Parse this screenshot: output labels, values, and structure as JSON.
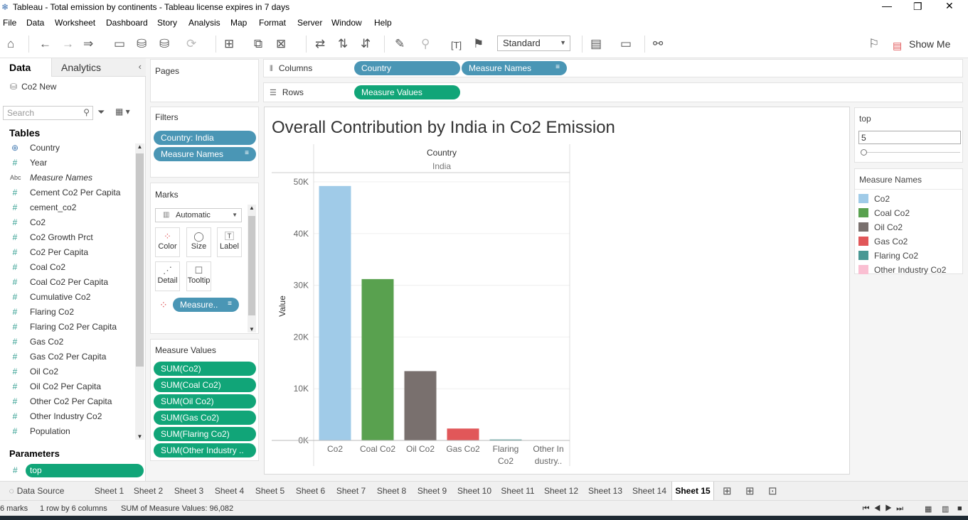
{
  "window": {
    "title": "Tableau - Total emission by continents - Tableau license expires in 7 days"
  },
  "menu": [
    "File",
    "Data",
    "Worksheet",
    "Dashboard",
    "Story",
    "Analysis",
    "Map",
    "Format",
    "Server",
    "Window",
    "Help"
  ],
  "toolbar": {
    "fit_mode": "Standard",
    "show_me_label": "Show Me"
  },
  "data_pane": {
    "tab_data": "Data",
    "tab_analytics": "Analytics",
    "datasource": "Co2 New",
    "search_placeholder": "Search",
    "tables_heading": "Tables",
    "fields": [
      {
        "name": "Country",
        "kind": "geo"
      },
      {
        "name": "Year",
        "kind": "measure"
      },
      {
        "name": "Measure Names",
        "kind": "dimension"
      },
      {
        "name": "Cement Co2 Per Capita",
        "kind": "measure"
      },
      {
        "name": "cement_co2",
        "kind": "measure"
      },
      {
        "name": "Co2",
        "kind": "measure"
      },
      {
        "name": "Co2 Growth Prct",
        "kind": "measure"
      },
      {
        "name": "Co2 Per Capita",
        "kind": "measure"
      },
      {
        "name": "Coal Co2",
        "kind": "measure"
      },
      {
        "name": "Coal Co2 Per Capita",
        "kind": "measure"
      },
      {
        "name": "Cumulative Co2",
        "kind": "measure"
      },
      {
        "name": "Flaring Co2",
        "kind": "measure"
      },
      {
        "name": "Flaring Co2 Per Capita",
        "kind": "measure"
      },
      {
        "name": "Gas Co2",
        "kind": "measure"
      },
      {
        "name": "Gas Co2 Per Capita",
        "kind": "measure"
      },
      {
        "name": "Oil Co2",
        "kind": "measure"
      },
      {
        "name": "Oil Co2 Per Capita",
        "kind": "measure"
      },
      {
        "name": "Other Co2 Per Capita",
        "kind": "measure"
      },
      {
        "name": "Other Industry Co2",
        "kind": "measure"
      },
      {
        "name": "Population",
        "kind": "measure"
      }
    ],
    "parameters_heading": "Parameters",
    "parameter": "top"
  },
  "shelves": {
    "pages_label": "Pages",
    "filters_label": "Filters",
    "filters": [
      "Country: India",
      "Measure Names"
    ],
    "marks_label": "Marks",
    "marks_type": "Automatic",
    "marks_buttons": {
      "color": "Color",
      "size": "Size",
      "label": "Label",
      "detail": "Detail",
      "tooltip": "Tooltip"
    },
    "marks_pill": "Measure..",
    "measure_values_label": "Measure Values",
    "measure_values": [
      "SUM(Co2)",
      "SUM(Coal Co2)",
      "SUM(Oil Co2)",
      "SUM(Gas Co2)",
      "SUM(Flaring Co2)",
      "SUM(Other Industry .."
    ],
    "columns_label": "Columns",
    "columns": [
      "Country",
      "Measure Names"
    ],
    "rows_label": "Rows",
    "rows": [
      "Measure Values"
    ]
  },
  "chart_data": {
    "type": "bar",
    "title": "Overall Contribution by India in Co2 Emission",
    "header_label": "Country",
    "header_value": "India",
    "ylabel": "Value",
    "ylim": [
      0,
      52000
    ],
    "yticks": [
      0,
      10000,
      20000,
      30000,
      40000,
      50000
    ],
    "ytick_labels": [
      "0K",
      "10K",
      "20K",
      "30K",
      "40K",
      "50K"
    ],
    "categories": [
      "Co2",
      "Coal Co2",
      "Oil Co2",
      "Gas Co2",
      "Flaring Co2",
      "Other Industry Co2"
    ],
    "category_labels": [
      [
        "Co2"
      ],
      [
        "Coal Co2"
      ],
      [
        "Oil Co2"
      ],
      [
        "Gas Co2"
      ],
      [
        "Flaring",
        "Co2"
      ],
      [
        "Other In",
        "dustry.."
      ]
    ],
    "values": [
      49200,
      31200,
      13400,
      2300,
      180,
      0
    ],
    "colors": [
      "#a0cbe8",
      "#59a14f",
      "#79706e",
      "#e15759",
      "#499894",
      "#fabfd2"
    ]
  },
  "parameter_card": {
    "title": "top",
    "value": "5"
  },
  "legend": {
    "title": "Measure Names",
    "items": [
      {
        "label": "Co2",
        "color": "#a0cbe8"
      },
      {
        "label": "Coal Co2",
        "color": "#59a14f"
      },
      {
        "label": "Oil Co2",
        "color": "#79706e"
      },
      {
        "label": "Gas Co2",
        "color": "#e15759"
      },
      {
        "label": "Flaring Co2",
        "color": "#499894"
      },
      {
        "label": "Other Industry Co2",
        "color": "#fabfd2"
      }
    ]
  },
  "sheet_tabs": {
    "data_source": "Data Source",
    "sheets": [
      "Sheet 1",
      "Sheet 2",
      "Sheet 3",
      "Sheet 4",
      "Sheet 5",
      "Sheet 6",
      "Sheet 7",
      "Sheet 8",
      "Sheet 9",
      "Sheet 10",
      "Sheet 11",
      "Sheet 12",
      "Sheet 13",
      "Sheet 14",
      "Sheet 15"
    ],
    "active": "Sheet 15"
  },
  "status": {
    "marks": "6 marks",
    "dims": "1 row by 6 columns",
    "sum": "SUM of Measure Values: 96,082"
  }
}
